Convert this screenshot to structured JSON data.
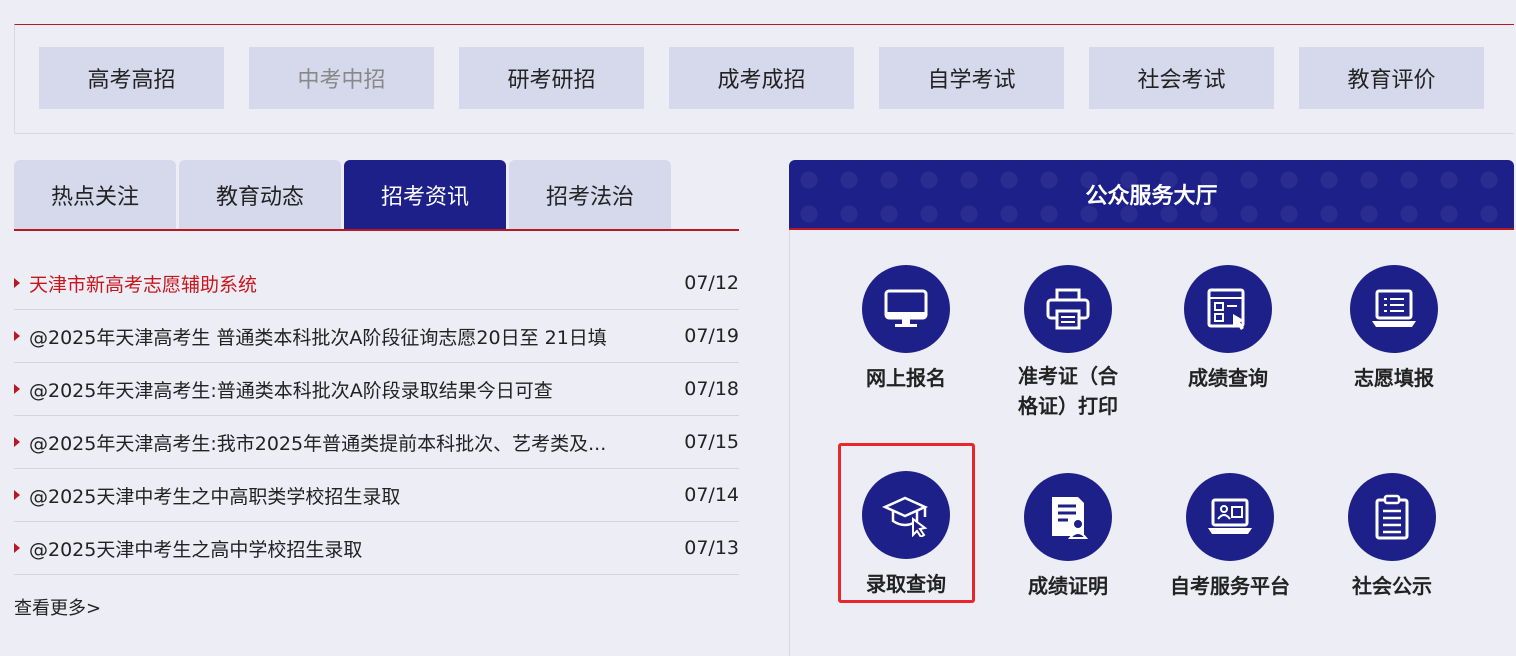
{
  "categories": [
    {
      "label": "高考高招",
      "dim": false
    },
    {
      "label": "中考中招",
      "dim": true
    },
    {
      "label": "研考研招",
      "dim": false
    },
    {
      "label": "成考成招",
      "dim": false
    },
    {
      "label": "自学考试",
      "dim": false
    },
    {
      "label": "社会考试",
      "dim": false
    },
    {
      "label": "教育评价",
      "dim": false
    }
  ],
  "tabs": [
    {
      "label": "热点关注"
    },
    {
      "label": "教育动态"
    },
    {
      "label": "招考资讯",
      "active": true
    },
    {
      "label": "招考法治"
    }
  ],
  "news": [
    {
      "title": "天津市新高考志愿辅助系统",
      "date": "07/12",
      "highlight": true
    },
    {
      "title": "@2025年天津高考生 普通类本科批次A阶段征询志愿20日至 21日填",
      "date": "07/19"
    },
    {
      "title": "@2025年天津高考生:普通类本科批次A阶段录取结果今日可查",
      "date": "07/18"
    },
    {
      "title": "@2025年天津高考生:我市2025年普通类提前本科批次、艺考类及...",
      "date": "07/15"
    },
    {
      "title": "@2025天津中考生之中高职类学校招生录取",
      "date": "07/14"
    },
    {
      "title": "@2025天津中考生之高中学校招生录取",
      "date": "07/13"
    }
  ],
  "more_label": "查看更多>",
  "hall": {
    "title": "公众服务大厅",
    "services": [
      {
        "label": "网上报名",
        "icon": "monitor-icon"
      },
      {
        "label": "准考证（合格证）打印",
        "icon": "printer-icon"
      },
      {
        "label": "成绩查询",
        "icon": "score-query-icon"
      },
      {
        "label": "志愿填报",
        "icon": "laptop-list-icon"
      },
      {
        "label": "录取查询",
        "icon": "graduation-cap-icon"
      },
      {
        "label": "成绩证明",
        "icon": "certificate-icon"
      },
      {
        "label": "自考服务平台",
        "icon": "service-platform-icon"
      },
      {
        "label": "社会公示",
        "icon": "clipboard-icon"
      }
    ]
  },
  "colors": {
    "brand": "#1d2088",
    "accent": "#b8181f",
    "highlight_box": "#e8262c"
  }
}
